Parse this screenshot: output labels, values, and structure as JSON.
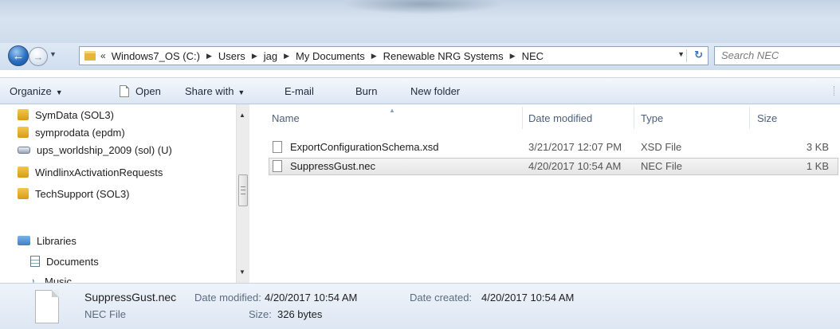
{
  "address": {
    "overflow": "«",
    "crumbs": [
      "Windows7_OS (C:)",
      "Users",
      "jag",
      "My Documents",
      "Renewable NRG Systems",
      "NEC"
    ]
  },
  "search": {
    "placeholder": "Search NEC"
  },
  "toolbar": {
    "organize": "Organize",
    "open": "Open",
    "share_with": "Share with",
    "email": "E-mail",
    "burn": "Burn",
    "new_folder": "New folder"
  },
  "sidebar": {
    "items": [
      {
        "label": "SymData (SOL3)",
        "icon": "shared-folder-icon"
      },
      {
        "label": "symprodata (epdm)",
        "icon": "shared-folder-icon"
      },
      {
        "label": "ups_worldship_2009 (sol) (U)",
        "icon": "network-drive-icon"
      },
      {
        "label": "WindlinxActivationRequests",
        "icon": "shared-folder-icon"
      },
      {
        "label": "TechSupport (SOL3)",
        "icon": "shared-folder-icon"
      }
    ],
    "libraries": "Libraries",
    "documents": "Documents",
    "music": "Music"
  },
  "columns": {
    "name": "Name",
    "date": "Date modified",
    "type": "Type",
    "size": "Size"
  },
  "files": [
    {
      "name": "ExportConfigurationSchema.xsd",
      "date": "3/21/2017 12:07 PM",
      "type": "XSD File",
      "size": "3 KB",
      "selected": false
    },
    {
      "name": "SuppressGust.nec",
      "date": "4/20/2017 10:54 AM",
      "type": "NEC File",
      "size": "1 KB",
      "selected": true
    }
  ],
  "details": {
    "filename": "SuppressGust.nec",
    "filetype": "NEC File",
    "date_modified_label": "Date modified:",
    "date_modified": "4/20/2017 10:54 AM",
    "date_created_label": "Date created:",
    "date_created": "4/20/2017 10:54 AM",
    "size_label": "Size:",
    "size": "326 bytes"
  }
}
